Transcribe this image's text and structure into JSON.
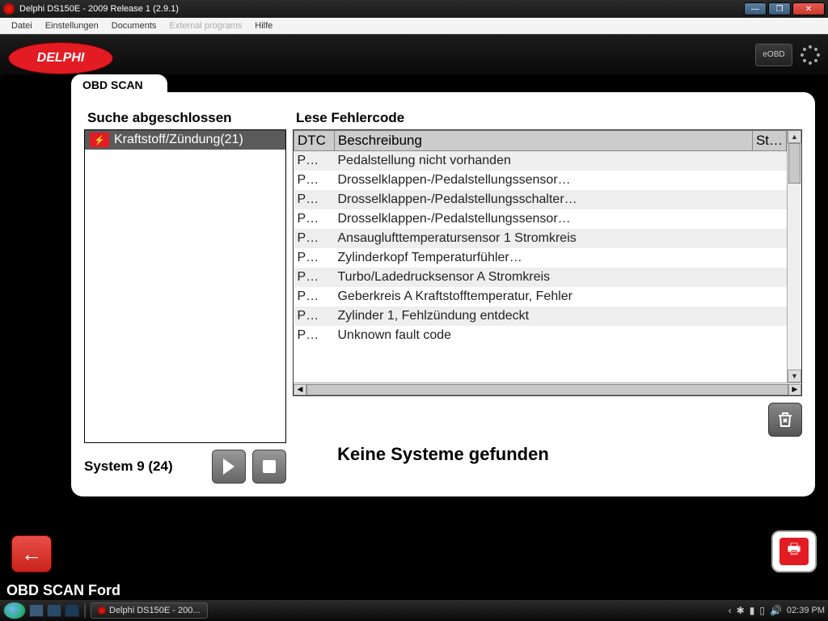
{
  "window": {
    "title": "Delphi DS150E - 2009 Release 1 (2.9.1)"
  },
  "menubar": {
    "datei": "Datei",
    "einstellungen": "Einstellungen",
    "documents": "Documents",
    "external": "External programs",
    "hilfe": "Hilfe"
  },
  "brand": {
    "logo_text": "DELPHI",
    "eobd": "eOBD"
  },
  "tab": {
    "label": "OBD SCAN"
  },
  "left": {
    "title": "Suche abgeschlossen",
    "item_label": "Kraftstoff/Zündung(21)",
    "footer": "System 9 (24)"
  },
  "right": {
    "title": "Lese Fehlercode",
    "col_dtc": "DTC",
    "col_desc": "Beschreibung",
    "col_st": "St…",
    "rows": [
      {
        "dtc": "P…",
        "desc": "Pedalstellung nicht vorhanden"
      },
      {
        "dtc": "P…",
        "desc": "Drosselklappen-/Pedalstellungssensor…"
      },
      {
        "dtc": "P…",
        "desc": "Drosselklappen-/Pedalstellungsschalter…"
      },
      {
        "dtc": "P…",
        "desc": "Drosselklappen-/Pedalstellungssensor…"
      },
      {
        "dtc": "P…",
        "desc": "Ansauglufttemperatursensor 1 Stromkreis"
      },
      {
        "dtc": "P…",
        "desc": "Zylinderkopf  Temperaturfühler…"
      },
      {
        "dtc": "P…",
        "desc": "Turbo/Ladedrucksensor A Stromkreis"
      },
      {
        "dtc": "P…",
        "desc": "Geberkreis A Kraftstofftemperatur, Fehler"
      },
      {
        "dtc": "P…",
        "desc": "Zylinder 1, Fehlzündung entdeckt"
      },
      {
        "dtc": "P…",
        "desc": "Unknown fault code"
      }
    ]
  },
  "no_systems": "Keine Systeme gefunden",
  "status": "OBD SCAN Ford",
  "taskbar": {
    "app_label": "Delphi DS150E - 200...",
    "clock": "02:39 PM"
  }
}
